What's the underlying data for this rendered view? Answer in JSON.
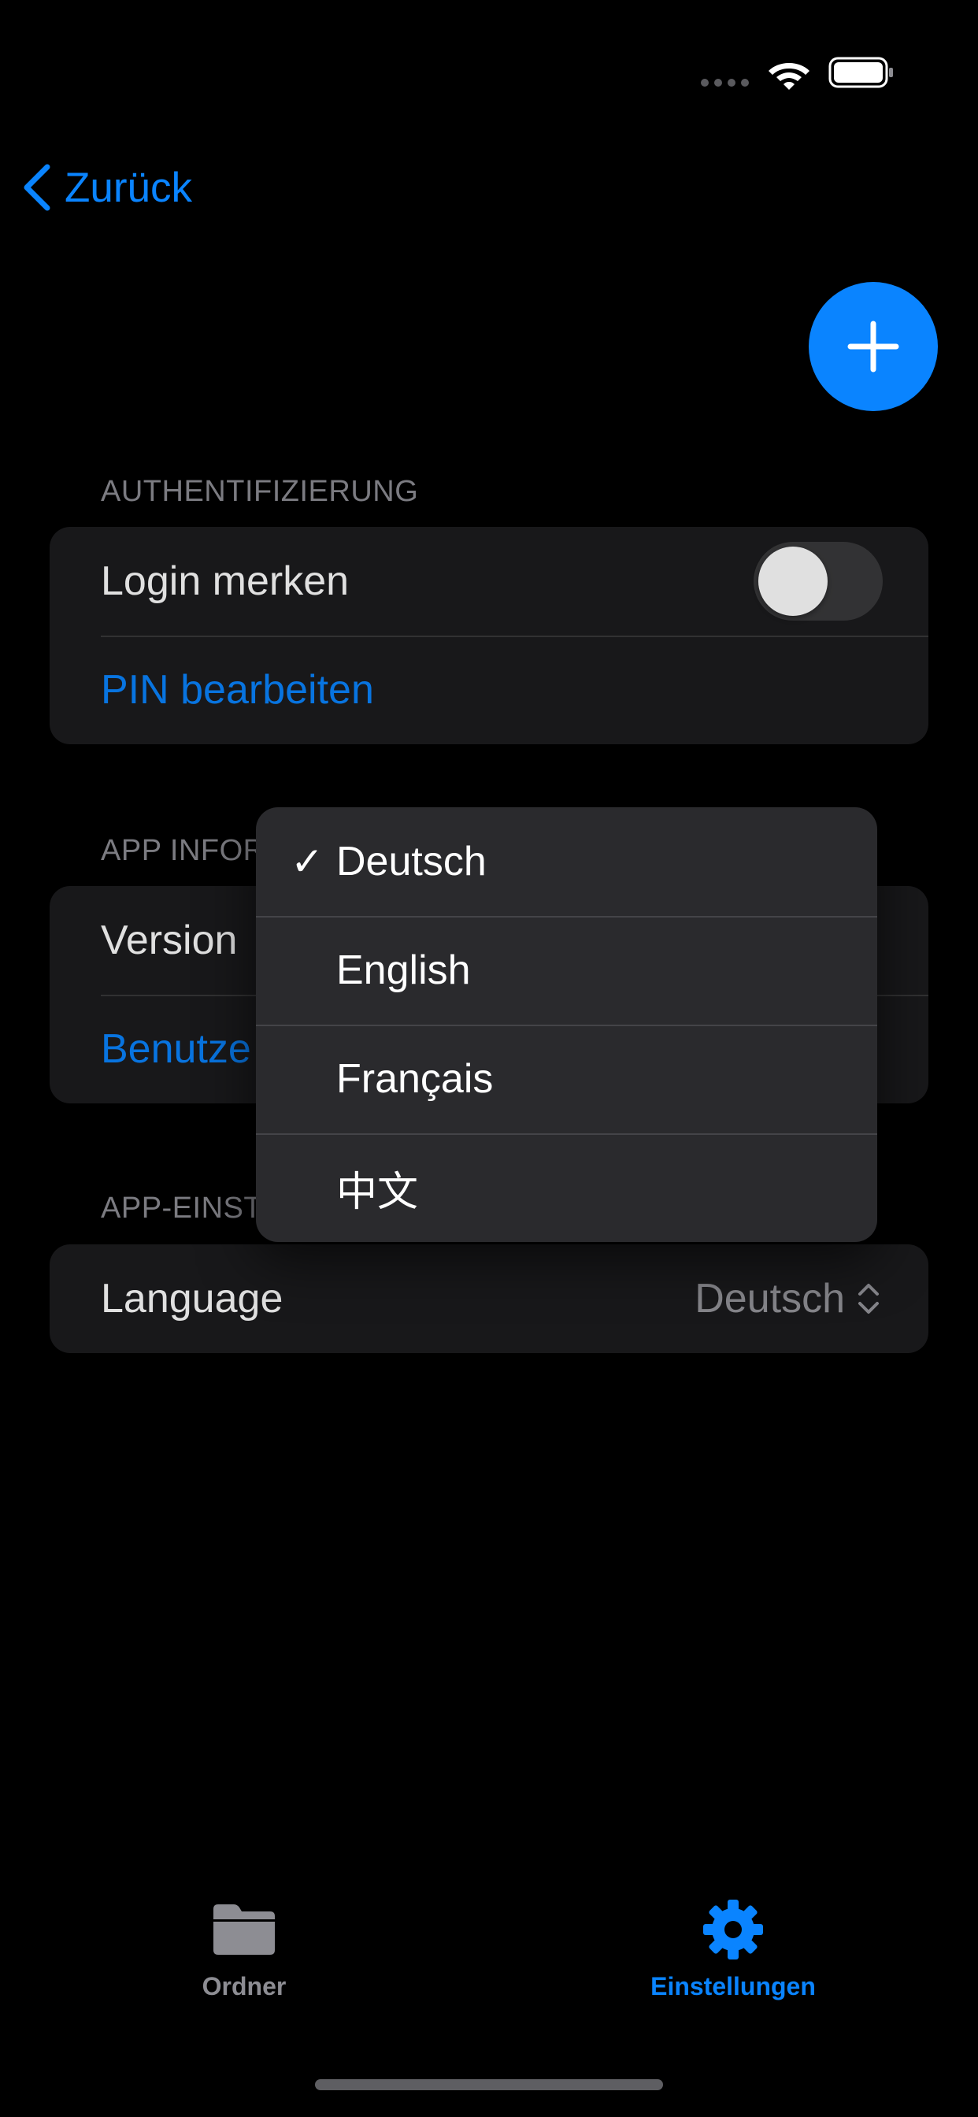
{
  "status_bar": {
    "wifi_icon": "wifi-icon",
    "battery_icon": "battery-icon"
  },
  "nav": {
    "back_label": "Zurück",
    "add_icon": "plus-icon"
  },
  "authentication": {
    "header": "AUTHENTIFIZIERUNG",
    "remember_login_label": "Login merken",
    "remember_login_on": false,
    "edit_pin_label": "PIN bearbeiten"
  },
  "app_info": {
    "header": "APP INFOR",
    "version_label": "Version",
    "link_label": "Benutze"
  },
  "app_settings": {
    "header": "APP-EINST",
    "language_label": "Language",
    "language_value": "Deutsch"
  },
  "language_menu": {
    "items": [
      {
        "label": "Deutsch",
        "checked": true,
        "check": "✓"
      },
      {
        "label": "English",
        "checked": false,
        "check": ""
      },
      {
        "label": "Français",
        "checked": false,
        "check": ""
      },
      {
        "label": "中文",
        "checked": false,
        "check": ""
      }
    ]
  },
  "tab_bar": {
    "tabs": [
      {
        "label": "Ordner",
        "icon": "folder-icon",
        "selected": false
      },
      {
        "label": "Einstellungen",
        "icon": "gear-icon",
        "selected": true
      }
    ]
  },
  "colors": {
    "accent": "#0a84ff",
    "background": "#000000",
    "card": "#1c1c1e",
    "menu": "#2a2a2d",
    "secondary_text": "#8d8d93"
  }
}
